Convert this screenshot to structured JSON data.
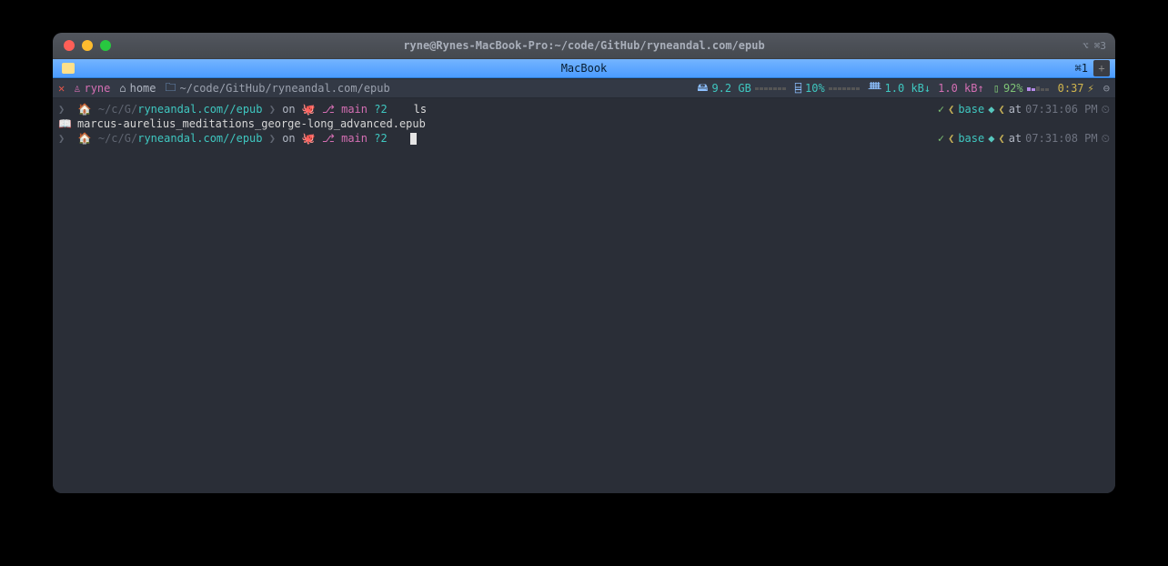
{
  "window": {
    "title": "ryne@Rynes-MacBook-Pro:~/code/GitHub/ryneandal.com/epub",
    "corner_shortcut": "⌘3",
    "corner_sym": "⌥"
  },
  "tab": {
    "label": "MacBook",
    "shortcut": "⌘1"
  },
  "statusbar": {
    "close": "✕",
    "user_icon": "ᚷ",
    "user": "ryne",
    "home_icon": "🏠",
    "home_label": "home",
    "folder_icon": "🗀",
    "path": "~/code/GitHub/ryneandal.com/epub",
    "disk_icon": "🖴",
    "disk": "9.2 GB",
    "cpu_icon": "⌸",
    "cpu": "10%",
    "net_icon": "ᚙ",
    "net_down": "1.0 kB↓",
    "net_up": "1.0 kB↑",
    "bat_icon": "▯",
    "battery": "92%",
    "clock": "0:37",
    "bolt": "⚡",
    "menu_icon": "⊖"
  },
  "prompt1": {
    "arrow": "❯",
    "apple": "",
    "home": "🏠",
    "path_pre": "~/c/G/",
    "path_hi": "ryneandal.com",
    "path_post": "/epub",
    "on": "on",
    "git_icon": "🐙",
    "branch_icon": "⎇",
    "branch": "main",
    "status": "?2",
    "cmd": "ls",
    "check": "✓",
    "ang_l": "❮",
    "env": "base",
    "diamond": "◆",
    "ang_r": "❮",
    "at": "at",
    "time": "07:31:06 PM",
    "clock": "⏲"
  },
  "output": {
    "file_icon": "📖",
    "filename": "marcus-aurelius_meditations_george-long_advanced.epub"
  },
  "prompt2": {
    "time": "07:31:08 PM"
  }
}
